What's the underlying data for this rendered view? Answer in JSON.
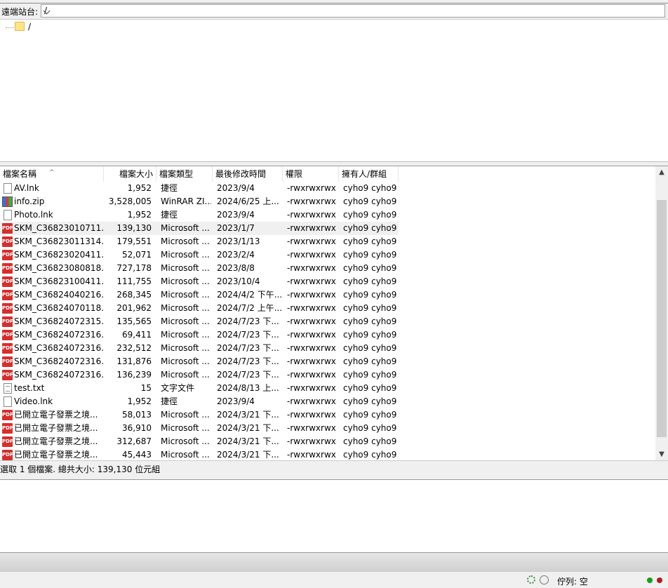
{
  "site_bar": {
    "label": "遠端站台:",
    "path": "/"
  },
  "tree": {
    "root_label": "/"
  },
  "file_list": {
    "columns": [
      "檔案名稱",
      "檔案大小",
      "檔案類型",
      "最後修改時間",
      "權限",
      "擁有人/群組"
    ],
    "rows": [
      {
        "icon": "file",
        "name": "AV.lnk",
        "size": "1,952",
        "type": "捷徑",
        "date": "2023/9/4",
        "perm": "-rwxrwxrwx",
        "owner": "cyho9 cyho9"
      },
      {
        "icon": "zip",
        "name": "info.zip",
        "size": "3,528,005",
        "type": "WinRAR ZI...",
        "date": "2024/6/25 上...",
        "perm": "-rwxrwxrwx",
        "owner": "cyho9 cyho9"
      },
      {
        "icon": "file",
        "name": "Photo.lnk",
        "size": "1,952",
        "type": "捷徑",
        "date": "2023/9/4",
        "perm": "-rwxrwxrwx",
        "owner": "cyho9 cyho9"
      },
      {
        "icon": "pdf",
        "name": "SKM_C36823010711...",
        "size": "139,130",
        "type": "Microsoft ...",
        "date": "2023/1/7",
        "perm": "-rwxrwxrwx",
        "owner": "cyho9 cyho9",
        "selected": true
      },
      {
        "icon": "pdf",
        "name": "SKM_C36823011314...",
        "size": "179,551",
        "type": "Microsoft ...",
        "date": "2023/1/13",
        "perm": "-rwxrwxrwx",
        "owner": "cyho9 cyho9"
      },
      {
        "icon": "pdf",
        "name": "SKM_C36823020411...",
        "size": "52,071",
        "type": "Microsoft ...",
        "date": "2023/2/4",
        "perm": "-rwxrwxrwx",
        "owner": "cyho9 cyho9"
      },
      {
        "icon": "pdf",
        "name": "SKM_C36823080818...",
        "size": "727,178",
        "type": "Microsoft ...",
        "date": "2023/8/8",
        "perm": "-rwxrwxrwx",
        "owner": "cyho9 cyho9"
      },
      {
        "icon": "pdf",
        "name": "SKM_C36823100411...",
        "size": "111,755",
        "type": "Microsoft ...",
        "date": "2023/10/4",
        "perm": "-rwxrwxrwx",
        "owner": "cyho9 cyho9"
      },
      {
        "icon": "pdf",
        "name": "SKM_C36824040216...",
        "size": "268,345",
        "type": "Microsoft ...",
        "date": "2024/4/2 下午...",
        "perm": "-rwxrwxrwx",
        "owner": "cyho9 cyho9"
      },
      {
        "icon": "pdf",
        "name": "SKM_C36824070118...",
        "size": "201,962",
        "type": "Microsoft ...",
        "date": "2024/7/2 上午...",
        "perm": "-rwxrwxrwx",
        "owner": "cyho9 cyho9"
      },
      {
        "icon": "pdf",
        "name": "SKM_C36824072315...",
        "size": "135,565",
        "type": "Microsoft ...",
        "date": "2024/7/23 下...",
        "perm": "-rwxrwxrwx",
        "owner": "cyho9 cyho9"
      },
      {
        "icon": "pdf",
        "name": "SKM_C36824072316...",
        "size": "69,411",
        "type": "Microsoft ...",
        "date": "2024/7/23 下...",
        "perm": "-rwxrwxrwx",
        "owner": "cyho9 cyho9"
      },
      {
        "icon": "pdf",
        "name": "SKM_C36824072316...",
        "size": "232,512",
        "type": "Microsoft ...",
        "date": "2024/7/23 下...",
        "perm": "-rwxrwxrwx",
        "owner": "cyho9 cyho9"
      },
      {
        "icon": "pdf",
        "name": "SKM_C36824072316...",
        "size": "131,876",
        "type": "Microsoft ...",
        "date": "2024/7/23 下...",
        "perm": "-rwxrwxrwx",
        "owner": "cyho9 cyho9"
      },
      {
        "icon": "pdf",
        "name": "SKM_C36824072316...",
        "size": "136,239",
        "type": "Microsoft ...",
        "date": "2024/7/23 下...",
        "perm": "-rwxrwxrwx",
        "owner": "cyho9 cyho9"
      },
      {
        "icon": "txt",
        "name": "test.txt",
        "size": "15",
        "type": "文字文件",
        "date": "2024/8/13 上...",
        "perm": "-rwxrwxrwx",
        "owner": "cyho9 cyho9"
      },
      {
        "icon": "file",
        "name": "Video.lnk",
        "size": "1,952",
        "type": "捷徑",
        "date": "2023/9/4",
        "perm": "-rwxrwxrwx",
        "owner": "cyho9 cyho9"
      },
      {
        "icon": "pdf",
        "name": "已開立電子發票之境...",
        "size": "58,013",
        "type": "Microsoft ...",
        "date": "2024/3/21 下...",
        "perm": "-rwxrwxrwx",
        "owner": "cyho9 cyho9"
      },
      {
        "icon": "pdf",
        "name": "已開立電子發票之境...",
        "size": "36,910",
        "type": "Microsoft ...",
        "date": "2024/3/21 下...",
        "perm": "-rwxrwxrwx",
        "owner": "cyho9 cyho9"
      },
      {
        "icon": "pdf",
        "name": "已開立電子發票之境...",
        "size": "312,687",
        "type": "Microsoft ...",
        "date": "2024/3/21 下...",
        "perm": "-rwxrwxrwx",
        "owner": "cyho9 cyho9"
      },
      {
        "icon": "pdf",
        "name": "已開立電子發票之境...",
        "size": "45,443",
        "type": "Microsoft ...",
        "date": "2024/3/21 下...",
        "perm": "-rwxrwxrwx",
        "owner": "cyho9 cyho9"
      }
    ]
  },
  "status_line": "選取 1 個檔案. 總共大小: 139,130 位元組",
  "bottom_bar": {
    "queue_label": "佇列: 空"
  },
  "colors": {
    "pdf_icon": "#d32f2f",
    "led_green": "#1d9a1d",
    "led_red": "#b01d1d",
    "selected_row": "#f0f0f0"
  }
}
